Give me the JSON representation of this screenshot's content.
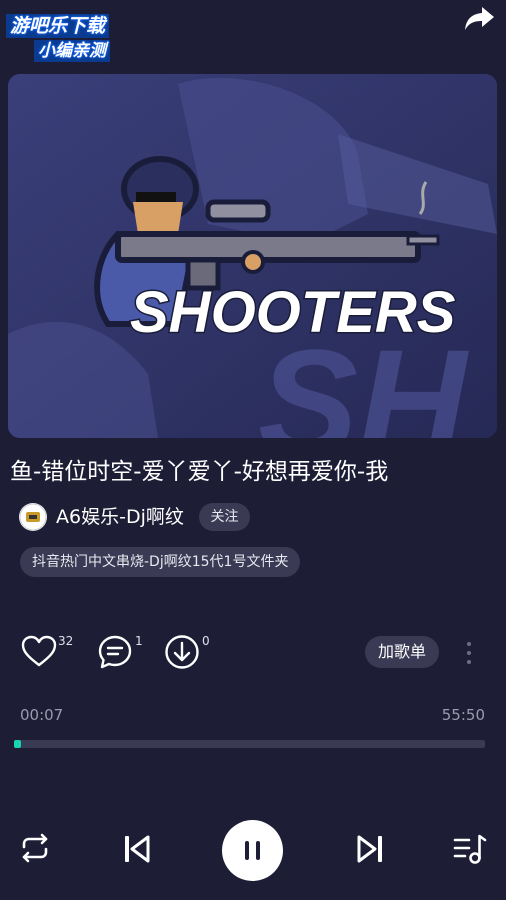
{
  "watermark": {
    "line1": "游吧乐下载",
    "line2": "小编亲测"
  },
  "cover": {
    "logo_text": "SHOOTERS",
    "bg_text": "SH"
  },
  "song": {
    "title": "鱼-错位时空-爱丫爱丫-好想再爱你-我"
  },
  "artist": {
    "name": "A6娱乐-Dj啊纹",
    "follow_label": "关注"
  },
  "folder": {
    "label": "抖音热门中文串烧-Dj啊纹15代1号文件夹"
  },
  "actions": {
    "like_count": "32",
    "comment_count": "1",
    "download_count": "0",
    "add_playlist_label": "加歌单"
  },
  "progress": {
    "current": "00:07",
    "total": "55:50",
    "fraction": 0.0021
  },
  "colors": {
    "background": "#1d1d36",
    "accent": "#18d6b1",
    "pill": "#3a3a54"
  }
}
